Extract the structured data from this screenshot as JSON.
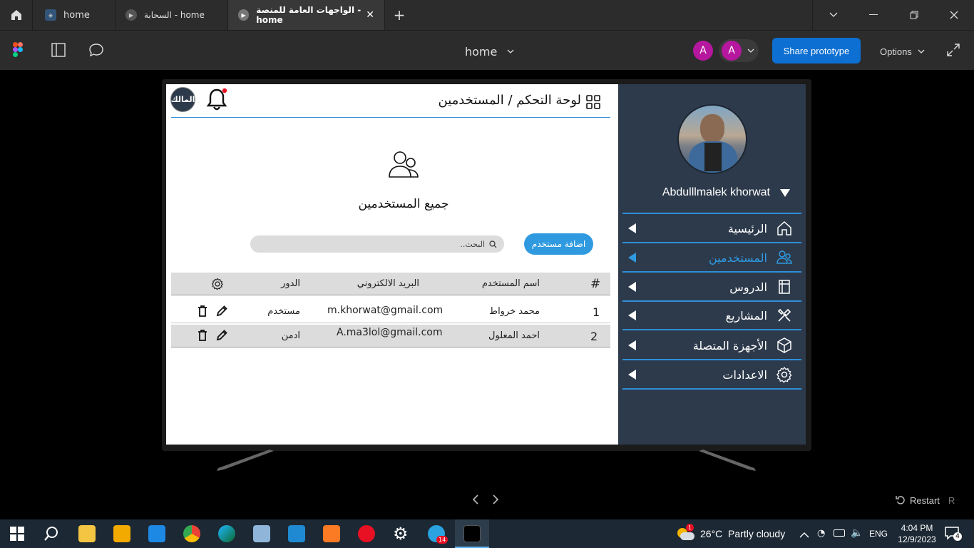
{
  "browser": {
    "tabs": [
      {
        "label": "home"
      },
      {
        "label": "السحابة - home"
      },
      {
        "label": "الواجهات العامة للمنصة - home"
      }
    ]
  },
  "toolbar": {
    "file_name": "home",
    "avatar_letter_1": "A",
    "avatar_letter_2": "A",
    "share_label": "Share prototype",
    "options_label": "Options"
  },
  "header": {
    "breadcrumb": "لوحة التحكم / المستخدمين",
    "owner_badge": "المالك"
  },
  "main": {
    "section_title": "جميع المستخدمين",
    "search_placeholder": "البحث..",
    "add_user_label": "اضافة مستخدم"
  },
  "table": {
    "columns": [
      "#",
      "اسم المستخدم",
      "البريد الالكتروني",
      "الدور"
    ],
    "rows": [
      {
        "num": "1",
        "name": "محمد خرواط",
        "email": "m.khorwat@gmail.com",
        "role": "مستخدم"
      },
      {
        "num": "2",
        "name": "احمد المعلول",
        "email": "A.ma3lol@gmail.com",
        "role": "ادمن"
      }
    ]
  },
  "sidebar": {
    "user_name": "Abdulllmalek khorwat",
    "items": [
      {
        "label": "الرئيسية",
        "icon": "home-icon"
      },
      {
        "label": "المستخدمين",
        "icon": "users-icon"
      },
      {
        "label": "الدروس",
        "icon": "book-icon"
      },
      {
        "label": "المشاريع",
        "icon": "tools-icon"
      },
      {
        "label": "الأجهزة المتصلة",
        "icon": "cube-icon"
      },
      {
        "label": "الاعدادات",
        "icon": "gear-icon"
      }
    ],
    "active_index": 1
  },
  "footer": {
    "restart_label": "Restart",
    "restart_key": "R"
  },
  "taskbar": {
    "weather": "26°C  Partly cloudy",
    "weather_badge": "1",
    "telegram_badge": "14",
    "lang": "ENG",
    "time": "4:04 PM",
    "date": "12/9/2023",
    "notif_count": "4"
  },
  "colors": {
    "accent": "#2f9ae0",
    "sidebar_bg": "#2d3a4b",
    "share_button": "#0d6fd1",
    "avatar": "#b5179e"
  }
}
